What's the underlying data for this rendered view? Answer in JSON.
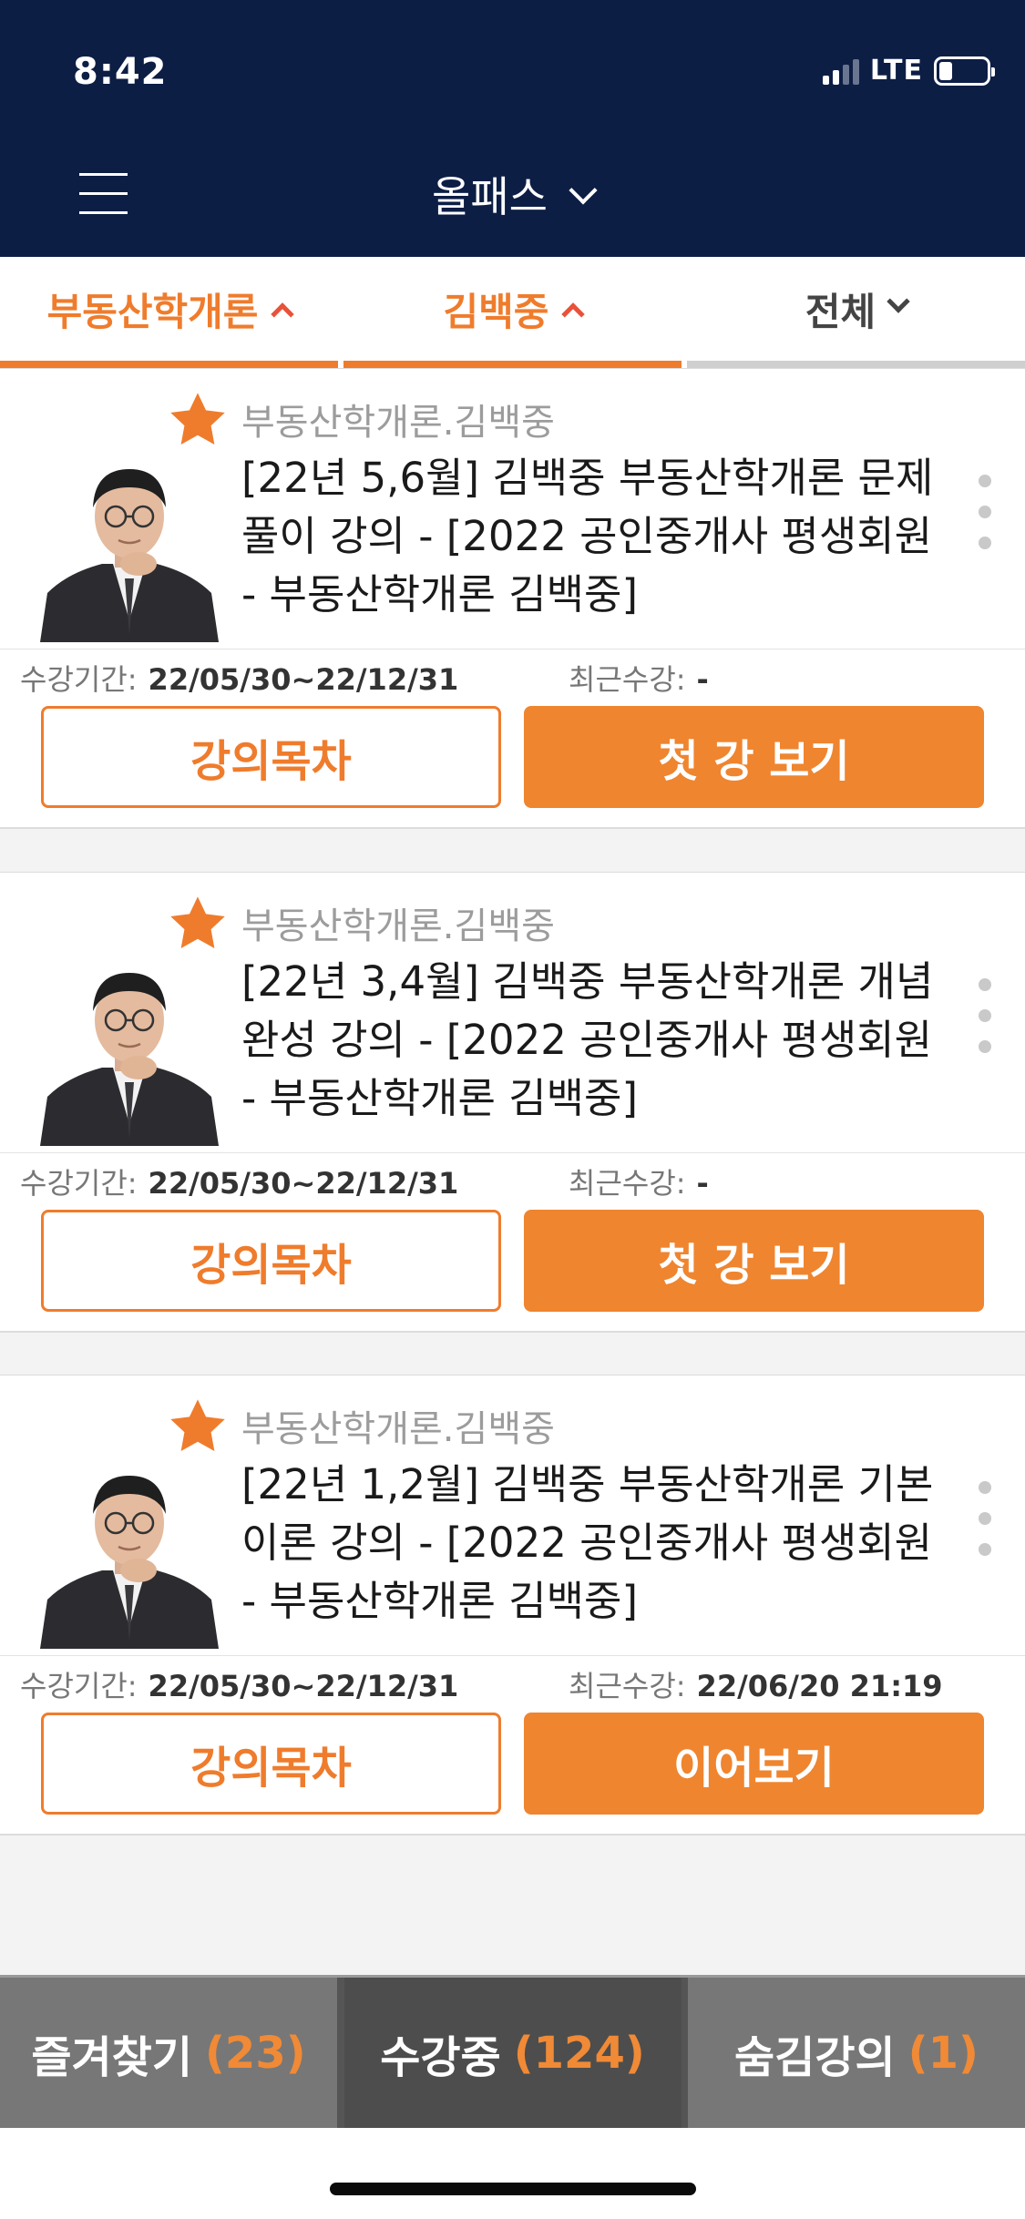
{
  "status_bar": {
    "time": "8:42",
    "network": "LTE"
  },
  "header": {
    "title": "올패스"
  },
  "filters": [
    {
      "label": "부동산학개론",
      "state": "active"
    },
    {
      "label": "김백중",
      "state": "active"
    },
    {
      "label": "전체",
      "state": "plain"
    }
  ],
  "courses": [
    {
      "category": "부동산학개론.김백중",
      "title": " [22년 5,6월] 김백중 부동산학개론 문제풀이 강의 - [2022 공인중개사 평생회원 - 부동산학개론 김백중]",
      "period_label": "수강기간:",
      "period_value": "22/05/30~22/12/31",
      "recent_label": "최근수강:",
      "recent_value": "-",
      "toc_button": "강의목차",
      "action_button": "첫 강 보기"
    },
    {
      "category": "부동산학개론.김백중",
      "title": " [22년 3,4월] 김백중 부동산학개론 개념완성 강의 - [2022 공인중개사 평생회원 - 부동산학개론 김백중]",
      "period_label": "수강기간:",
      "period_value": "22/05/30~22/12/31",
      "recent_label": "최근수강:",
      "recent_value": "-",
      "toc_button": "강의목차",
      "action_button": "첫 강 보기"
    },
    {
      "category": "부동산학개론.김백중",
      "title": " [22년 1,2월] 김백중 부동산학개론 기본이론 강의 - [2022 공인중개사 평생회원 - 부동산학개론 김백중]",
      "period_label": "수강기간:",
      "period_value": "22/05/30~22/12/31",
      "recent_label": "최근수강:",
      "recent_value": "22/06/20 21:19",
      "toc_button": "강의목차",
      "action_button": "이어보기"
    }
  ],
  "bottom_tabs": [
    {
      "label": "즐겨찾기",
      "count": "(23)"
    },
    {
      "label": "수강중",
      "count": "(124)"
    },
    {
      "label": "숨김강의",
      "count": "(1)"
    }
  ],
  "colors": {
    "header_bg": "#0d1e45",
    "accent": "#ef7c2c",
    "tab_active_bg": "#4d4d4d",
    "tab_bg": "#777777"
  },
  "icons": {
    "menu": "hamburger-icon",
    "favorite": "star-icon",
    "more": "kebab-icon",
    "dropdown": "chevron-down-icon",
    "sort": "caret-up-icon"
  }
}
